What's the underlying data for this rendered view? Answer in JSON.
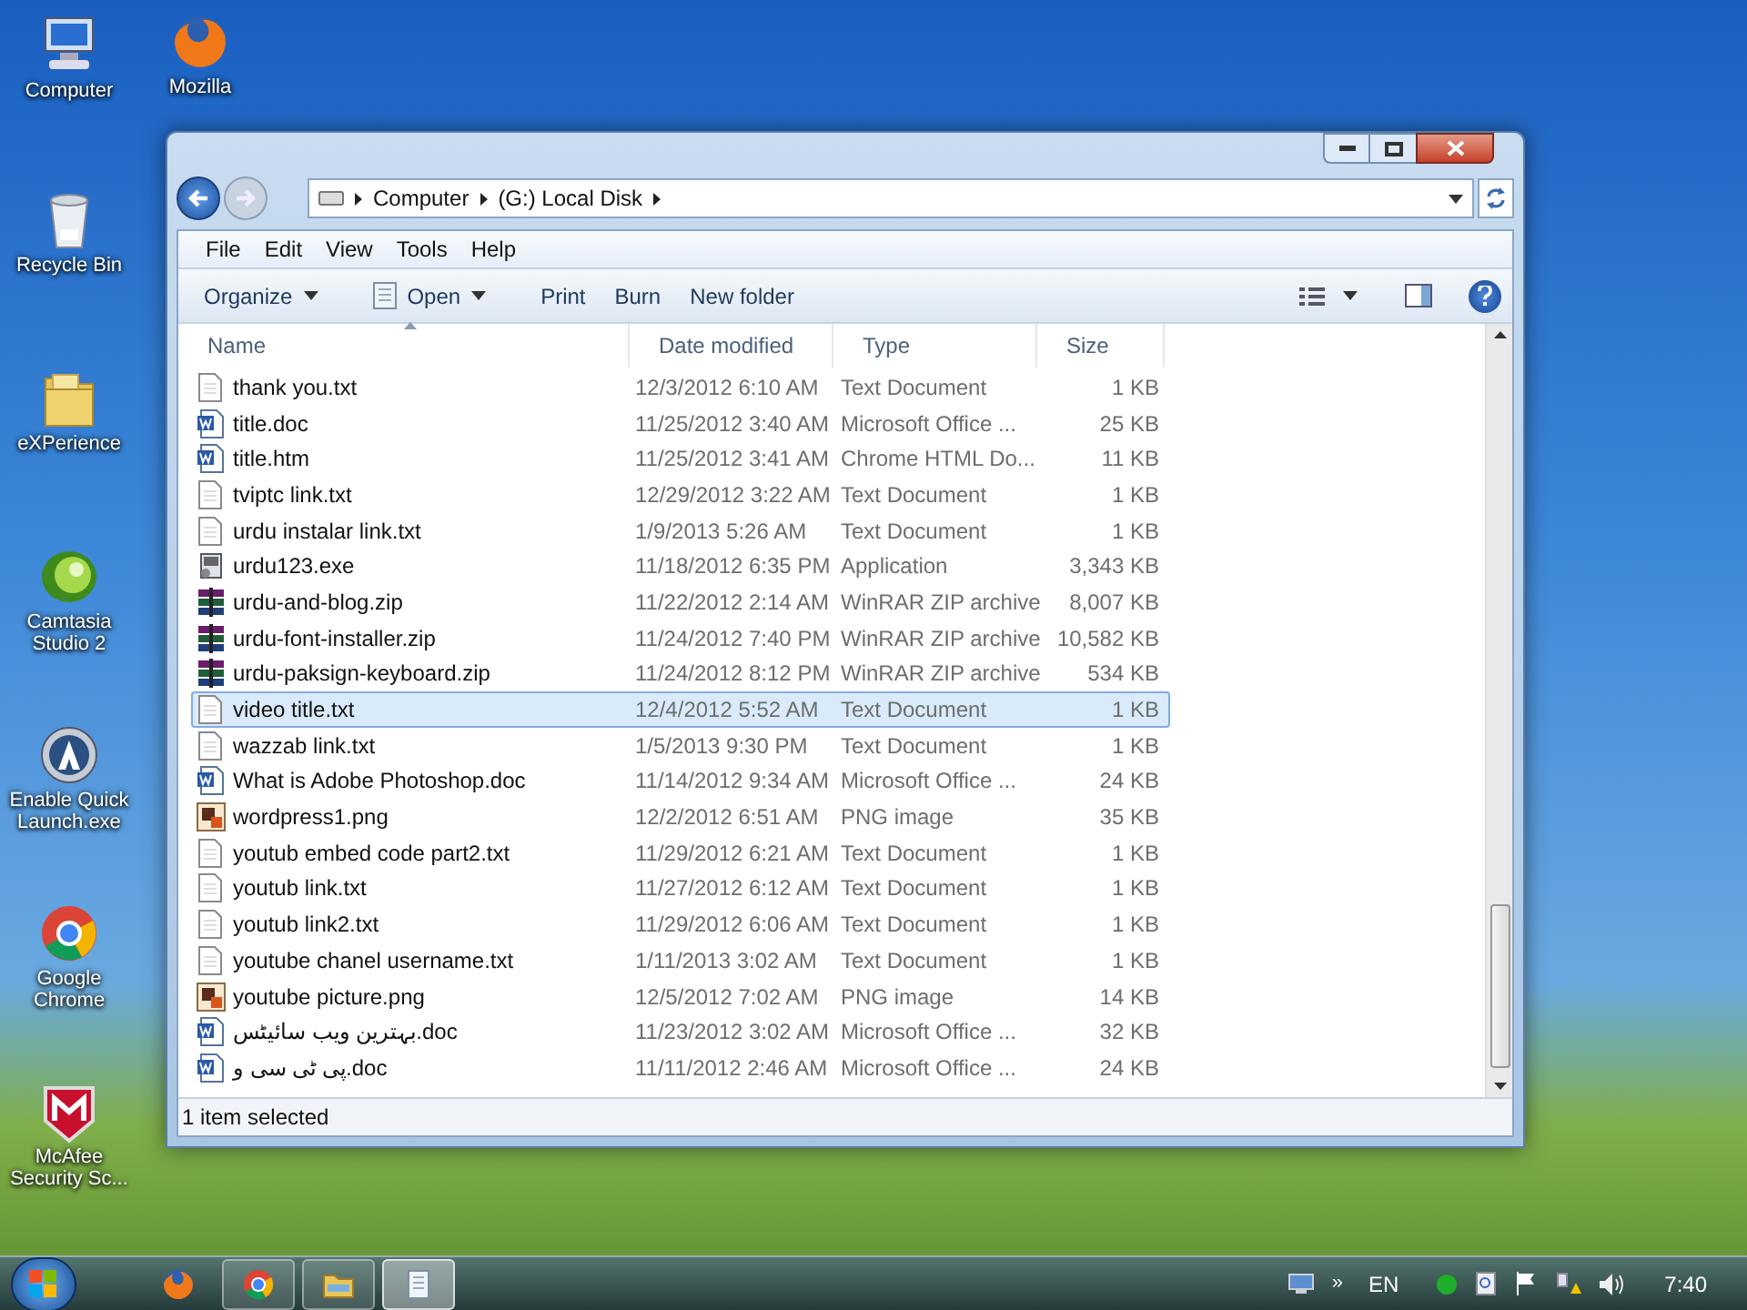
{
  "desktop_icons": [
    {
      "label": "Computer",
      "kind": "computer"
    },
    {
      "label": "Mozilla",
      "kind": "firefox"
    },
    {
      "label": "Recycle Bin",
      "kind": "recycle"
    },
    {
      "label": "eXPerience",
      "kind": "folder"
    },
    {
      "label": "Camtasia Studio 2",
      "kind": "camtasia"
    },
    {
      "label": "Enable Quick Launch.exe",
      "kind": "quicklaunch"
    },
    {
      "label": "Google Chrome",
      "kind": "chrome"
    },
    {
      "label": "McAfee Security Sc...",
      "kind": "mcafee"
    }
  ],
  "window": {
    "address": [
      "Computer",
      "(G:) Local Disk"
    ],
    "menu": [
      "File",
      "Edit",
      "View",
      "Tools",
      "Help"
    ],
    "toolbar": [
      {
        "label": "Organize",
        "kind": "dropdown"
      },
      {
        "label": "Open",
        "kind": "open"
      },
      {
        "label": "Print",
        "kind": "plain"
      },
      {
        "label": "Burn",
        "kind": "plain"
      },
      {
        "label": "New folder",
        "kind": "plain"
      }
    ],
    "columns": [
      {
        "label": "Name",
        "sorted": true
      },
      {
        "label": "Date modified",
        "sorted": false
      },
      {
        "label": "Type",
        "sorted": false
      },
      {
        "label": "Size",
        "sorted": false
      }
    ],
    "rows": [
      {
        "name": "thank you.txt",
        "date": "12/3/2012 6:10 AM",
        "type": "Text Document",
        "size": "1 KB",
        "kind": "txt",
        "selected": false
      },
      {
        "name": "title.doc",
        "date": "11/25/2012 3:40 AM",
        "type": "Microsoft Office ...",
        "size": "25 KB",
        "kind": "doc",
        "selected": false
      },
      {
        "name": "title.htm",
        "date": "11/25/2012 3:41 AM",
        "type": "Chrome HTML Do...",
        "size": "11 KB",
        "kind": "doc",
        "selected": false
      },
      {
        "name": "tviptc link.txt",
        "date": "12/29/2012 3:22 AM",
        "type": "Text Document",
        "size": "1 KB",
        "kind": "txt",
        "selected": false
      },
      {
        "name": "urdu instalar link.txt",
        "date": "1/9/2013 5:26 AM",
        "type": "Text Document",
        "size": "1 KB",
        "kind": "txt",
        "selected": false
      },
      {
        "name": "urdu123.exe",
        "date": "11/18/2012 6:35 PM",
        "type": "Application",
        "size": "3,343 KB",
        "kind": "exe",
        "selected": false
      },
      {
        "name": "urdu-and-blog.zip",
        "date": "11/22/2012 2:14 AM",
        "type": "WinRAR ZIP archive",
        "size": "8,007 KB",
        "kind": "zip",
        "selected": false
      },
      {
        "name": "urdu-font-installer.zip",
        "date": "11/24/2012 7:40 PM",
        "type": "WinRAR ZIP archive",
        "size": "10,582 KB",
        "kind": "zip",
        "selected": false
      },
      {
        "name": "urdu-paksign-keyboard.zip",
        "date": "11/24/2012 8:12 PM",
        "type": "WinRAR ZIP archive",
        "size": "534 KB",
        "kind": "zip",
        "selected": false
      },
      {
        "name": "video title.txt",
        "date": "12/4/2012 5:52 AM",
        "type": "Text Document",
        "size": "1 KB",
        "kind": "txt",
        "selected": true
      },
      {
        "name": "wazzab link.txt",
        "date": "1/5/2013 9:30 PM",
        "type": "Text Document",
        "size": "1 KB",
        "kind": "txt",
        "selected": false
      },
      {
        "name": "What is Adobe Photoshop.doc",
        "date": "11/14/2012 9:34 AM",
        "type": "Microsoft Office ...",
        "size": "24 KB",
        "kind": "doc",
        "selected": false
      },
      {
        "name": "wordpress1.png",
        "date": "12/2/2012 6:51 AM",
        "type": "PNG image",
        "size": "35 KB",
        "kind": "png",
        "selected": false
      },
      {
        "name": "youtub embed code part2.txt",
        "date": "11/29/2012 6:21 AM",
        "type": "Text Document",
        "size": "1 KB",
        "kind": "txt",
        "selected": false
      },
      {
        "name": "youtub link.txt",
        "date": "11/27/2012 6:12 AM",
        "type": "Text Document",
        "size": "1 KB",
        "kind": "txt",
        "selected": false
      },
      {
        "name": "youtub link2.txt",
        "date": "11/29/2012 6:06 AM",
        "type": "Text Document",
        "size": "1 KB",
        "kind": "txt",
        "selected": false
      },
      {
        "name": "youtube chanel username.txt",
        "date": "1/11/2013 3:02 AM",
        "type": "Text Document",
        "size": "1 KB",
        "kind": "txt",
        "selected": false
      },
      {
        "name": "youtube picture.png",
        "date": "12/5/2012 7:02 AM",
        "type": "PNG image",
        "size": "14 KB",
        "kind": "png",
        "selected": false
      },
      {
        "name": "بہترین ویب سائیٹس.doc",
        "date": "11/23/2012 3:02 AM",
        "type": "Microsoft Office ...",
        "size": "32 KB",
        "kind": "doc",
        "selected": false
      },
      {
        "name": "پی ٹی سی و.doc",
        "date": "11/11/2012 2:46 AM",
        "type": "Microsoft Office ...",
        "size": "24 KB",
        "kind": "doc",
        "selected": false
      }
    ],
    "status": "1 item selected"
  },
  "taskbar": {
    "apps": [
      {
        "kind": "firefox",
        "selected": false
      },
      {
        "kind": "chrome",
        "selected": false
      },
      {
        "kind": "explorer",
        "selected": false
      },
      {
        "kind": "notepad",
        "selected": true
      }
    ],
    "overflow": "»",
    "language": "EN",
    "clock": "7:40"
  }
}
